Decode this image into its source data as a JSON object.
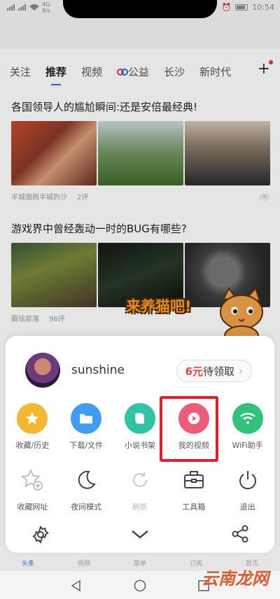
{
  "status_bar": {
    "network": "4G\n8/s",
    "time": "10:54"
  },
  "tabs": [
    {
      "label": "关注",
      "active": false
    },
    {
      "label": "推荐",
      "active": true
    },
    {
      "label": "视频",
      "active": false
    },
    {
      "label": "公益",
      "active": false,
      "icon": "gongyi-logo"
    },
    {
      "label": "长沙",
      "active": false
    },
    {
      "label": "新时代",
      "active": false
    }
  ],
  "news": [
    {
      "title": "各国领导人的尴尬瞬间:还是安倍最经典!",
      "source": "半城烟雨半城的沙",
      "comments": "2评"
    },
    {
      "title": "游戏界中曾经轰动一时的BUG有哪些?",
      "source": "霸铭部落",
      "comments": "96评"
    }
  ],
  "sticker": {
    "text": "来养猫吧!"
  },
  "sheet": {
    "username": "sunshine",
    "reward": {
      "amount": "6元",
      "text": "待领取",
      "arrow": "›"
    },
    "row1": [
      {
        "label": "收藏/历史",
        "icon": "star-icon",
        "color": "#f5b72f"
      },
      {
        "label": "下载/文件",
        "icon": "folder-icon",
        "color": "#3e9cf2"
      },
      {
        "label": "小说书架",
        "icon": "book-icon",
        "color": "#2fc4a4"
      },
      {
        "label": "我的视频",
        "icon": "play-icon",
        "color": "#f25a7c"
      },
      {
        "label": "WiFi助手",
        "icon": "wifi-icon",
        "color": "#30c27a"
      }
    ],
    "row2": [
      {
        "label": "收藏网址",
        "icon": "star-add-icon"
      },
      {
        "label": "夜间模式",
        "icon": "moon-icon"
      },
      {
        "label": "刷新",
        "icon": "refresh-icon"
      },
      {
        "label": "工具箱",
        "icon": "toolbox-icon"
      },
      {
        "label": "退出",
        "icon": "power-icon"
      }
    ]
  },
  "bottom_nav": [
    "头条",
    "视频",
    "菜单",
    "订阅",
    "首页"
  ],
  "watermark": "云南龙网"
}
